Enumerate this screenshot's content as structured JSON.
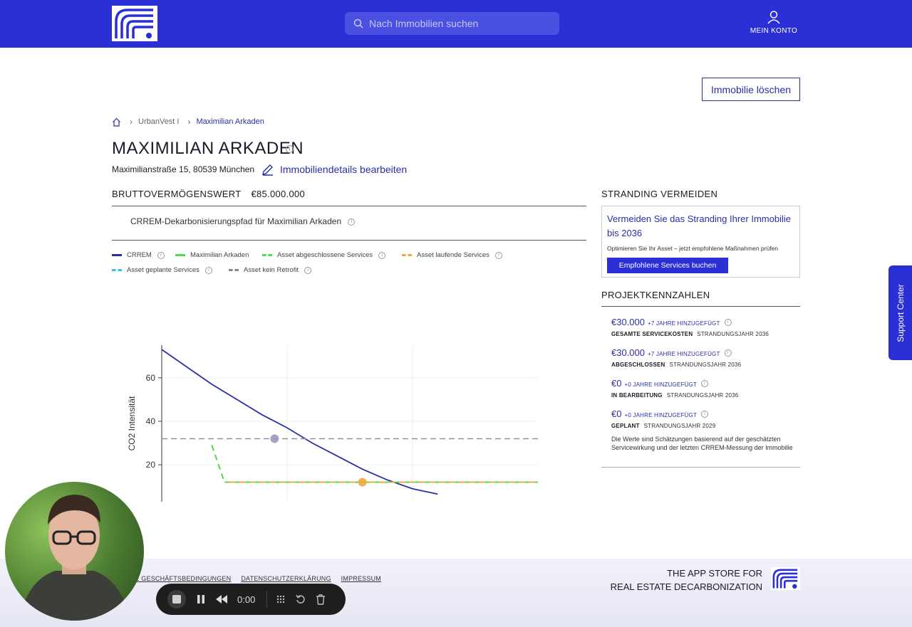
{
  "header": {
    "search_placeholder": "Nach Immobilien suchen",
    "account_label": "MEIN KONTO"
  },
  "actions": {
    "delete_label": "Immobilie löschen"
  },
  "breadcrumb": {
    "items": [
      "UrbanVest I",
      "Maximilian Arkaden"
    ]
  },
  "property": {
    "title": "MAXIMILIAN ARKADEN",
    "address": "Maximilianstraße 15, 80539 München",
    "edit_label": "Immobiliendetails bearbeiten",
    "gross_label": "BRUTTOVERMÖGENSWERT",
    "gross_value": "€85.000.000"
  },
  "pathway": {
    "title": "CRREM-Dekarbonisierungspfad für Maximilian Arkaden"
  },
  "legend": [
    {
      "label": "CRREM",
      "color": "#2a2fa8",
      "style": "solid"
    },
    {
      "label": "Maximilian Arkaden",
      "color": "#4ddc4d",
      "style": "solid"
    },
    {
      "label": "Asset abgeschlossene Services",
      "color": "#4ddc4d",
      "style": "dashed"
    },
    {
      "label": "Asset laufende Services",
      "color": "#f0a840",
      "style": "dashed"
    },
    {
      "label": "Asset geplante Services",
      "color": "#30c8e8",
      "style": "dashed"
    },
    {
      "label": "Asset kein Retrofit",
      "color": "#888888",
      "style": "dashed"
    }
  ],
  "chart_data": {
    "type": "line",
    "ylabel": "CO2 Intensität",
    "yticks": [
      20,
      40,
      60
    ],
    "ylim": [
      3,
      75
    ],
    "xlim": [
      0,
      30
    ],
    "series": [
      {
        "name": "CRREM",
        "x": [
          0,
          2,
          4,
          6,
          8,
          10,
          12,
          14,
          16,
          18,
          20,
          22
        ],
        "y": [
          73,
          65,
          57,
          50,
          43,
          37,
          30,
          24,
          18,
          13,
          9,
          6.5
        ]
      },
      {
        "name": "Asset abgeschlossene Services",
        "x": [
          4,
          5,
          30
        ],
        "y": [
          29,
          12,
          12
        ]
      },
      {
        "name": "Asset laufende Services",
        "x": [
          5,
          30
        ],
        "y": [
          12,
          12
        ]
      },
      {
        "name": "Asset kein Retrofit",
        "x": [
          0,
          30
        ],
        "y": [
          32,
          32
        ]
      }
    ],
    "markers": [
      {
        "x": 9,
        "y": 32,
        "color": "#9a9ab8"
      },
      {
        "x": 16,
        "y": 12,
        "color": "#f0a840"
      }
    ]
  },
  "sidebar": {
    "stranding_heading": "STRANDING VERMEIDEN",
    "promo_title": "Vermeiden Sie das Stranding Ihrer Immobilie bis 2036",
    "promo_sub": "Optimieren Sie Ihr Asset – jetzt empfohlene Maßnahmen prüfen",
    "promo_button": "Empfohlene Services buchen",
    "kpi_heading": "PROJEKTKENNZAHLEN",
    "kpis": [
      {
        "amount": "€30.000",
        "years": "+7 JAHRE HINZUGEFÜGT",
        "label": "GESAMTE SERVICEKOSTEN",
        "stranding": "STRANDUNGSJAHR 2036"
      },
      {
        "amount": "€30.000",
        "years": "+7 JAHRE HINZUGEFÜGT",
        "label": "ABGESCHLOSSEN",
        "stranding": "STRANDUNGSJAHR 2036"
      },
      {
        "amount": "€0",
        "years": "+0 JAHRE HINZUGEFÜGT",
        "label": "IN BEARBEITUNG",
        "stranding": "STRANDUNGSJAHR 2036"
      },
      {
        "amount": "€0",
        "years": "+0 JAHRE HINZUGEFÜGT",
        "label": "GEPLANT",
        "stranding": "STRANDUNGSJAHR 2029"
      }
    ],
    "note": "Die Werte sind Schätzungen basierend auf der geschätzten Servicewirkung und der letzten CRREM-Messung der Immobilie"
  },
  "support": {
    "label": "Support Center"
  },
  "footer": {
    "links": [
      "INE GESCHÄFTSBEDINGUNGEN",
      "DATENSCHUTZERKLÄRUNG",
      "IMPRESSUM"
    ],
    "tagline_1": "THE APP STORE FOR",
    "tagline_2": "REAL ESTATE DECARBONIZATION"
  },
  "recorder": {
    "time": "0:00"
  },
  "colors": {
    "brand": "#2a2fd6",
    "accent": "#2a2fa8"
  }
}
